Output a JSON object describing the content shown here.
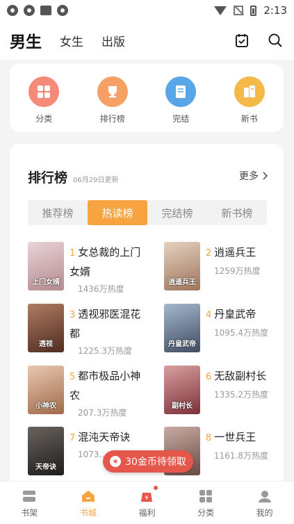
{
  "status_bar": {
    "time": "2:13"
  },
  "header": {
    "tabs": [
      {
        "label": "男生",
        "active": true
      },
      {
        "label": "女生",
        "active": false
      },
      {
        "label": "出版",
        "active": false
      }
    ]
  },
  "categories": [
    {
      "label": "分类",
      "icon": "grid-icon",
      "color": "#f58a78"
    },
    {
      "label": "排行榜",
      "icon": "trophy-icon",
      "color": "#f6a065"
    },
    {
      "label": "完结",
      "icon": "book-icon",
      "color": "#58a6e8"
    },
    {
      "label": "新书",
      "icon": "new-book-icon",
      "color": "#f5b94a"
    }
  ],
  "ranking": {
    "title": "排行榜",
    "date": "06月29日更新",
    "more": "更多",
    "tabs": [
      {
        "label": "推荐榜",
        "active": false
      },
      {
        "label": "热读榜",
        "active": true
      },
      {
        "label": "完结榜",
        "active": false
      },
      {
        "label": "新书榜",
        "active": false
      }
    ],
    "books": [
      {
        "rank": "1",
        "title": "女总裁的上门女婿",
        "heat": "1436万热度",
        "cover_text": "上门女婿",
        "cover_color": "#d9c3c6"
      },
      {
        "rank": "2",
        "title": "逍遥兵王",
        "heat": "1259万热度",
        "cover_text": "逍遥兵王",
        "cover_color": "#c9a78c"
      },
      {
        "rank": "3",
        "title": "透视邪医混花都",
        "heat": "1225.3万热度",
        "cover_text": "透视",
        "cover_color": "#8a5a48"
      },
      {
        "rank": "4",
        "title": "丹皇武帝",
        "heat": "1095.4万热度",
        "cover_text": "丹皇武帝",
        "cover_color": "#6d7f9a"
      },
      {
        "rank": "5",
        "title": "都市极品小神农",
        "heat": "207.3万热度",
        "cover_text": "小神农",
        "cover_color": "#c79a7a"
      },
      {
        "rank": "6",
        "title": "无敌副村长",
        "heat": "1335.2万热度",
        "cover_text": "副村长",
        "cover_color": "#b46064"
      },
      {
        "rank": "7",
        "title": "混沌天帝诀",
        "heat": "1073...",
        "cover_text": "天帝诀",
        "cover_color": "#3d3a38"
      },
      {
        "rank": "8",
        "title": "一世兵王",
        "heat": "1161.8万热度",
        "cover_text": "",
        "cover_color": "#9c7e76"
      }
    ]
  },
  "toast": {
    "label": "30金币待领取"
  },
  "bottom_nav": [
    {
      "label": "书架",
      "icon": "bookshelf-icon",
      "active": false
    },
    {
      "label": "书城",
      "icon": "bookstore-icon",
      "active": true
    },
    {
      "label": "福利",
      "icon": "gift-bag-icon",
      "active": false
    },
    {
      "label": "分类",
      "icon": "category-grid-icon",
      "active": false
    },
    {
      "label": "我的",
      "icon": "profile-icon",
      "active": false
    }
  ]
}
